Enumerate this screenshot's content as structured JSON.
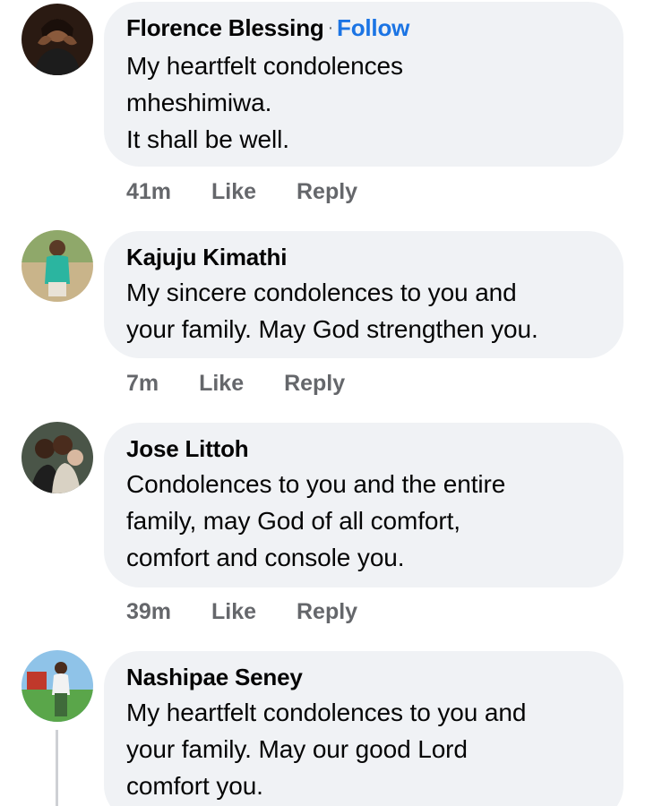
{
  "comments": [
    {
      "author": "Florence Blessing",
      "follow_separator": "·",
      "follow_label": "Follow",
      "lines": [
        "My heartfelt condolences",
        "mheshimiwa.",
        "It shall be well."
      ],
      "time": "41m",
      "like_label": "Like",
      "reply_label": "Reply"
    },
    {
      "author": "Kajuju Kimathi",
      "lines": [
        "My sincere condolences to you and",
        "your family. May God strengthen you."
      ],
      "time": "7m",
      "like_label": "Like",
      "reply_label": "Reply"
    },
    {
      "author": "Jose Littoh",
      "lines": [
        "Condolences to you and the entire",
        "family, may God of all comfort,",
        "comfort and console you."
      ],
      "time": "39m",
      "like_label": "Like",
      "reply_label": "Reply"
    },
    {
      "author": "Nashipae Seney",
      "lines": [
        "My heartfelt condolences to you and",
        "your family. May our good Lord",
        "comfort you."
      ]
    }
  ],
  "colors": {
    "bubble": "#f0f2f5",
    "follow": "#1b74e4",
    "meta": "#65676b",
    "text": "#050505"
  }
}
